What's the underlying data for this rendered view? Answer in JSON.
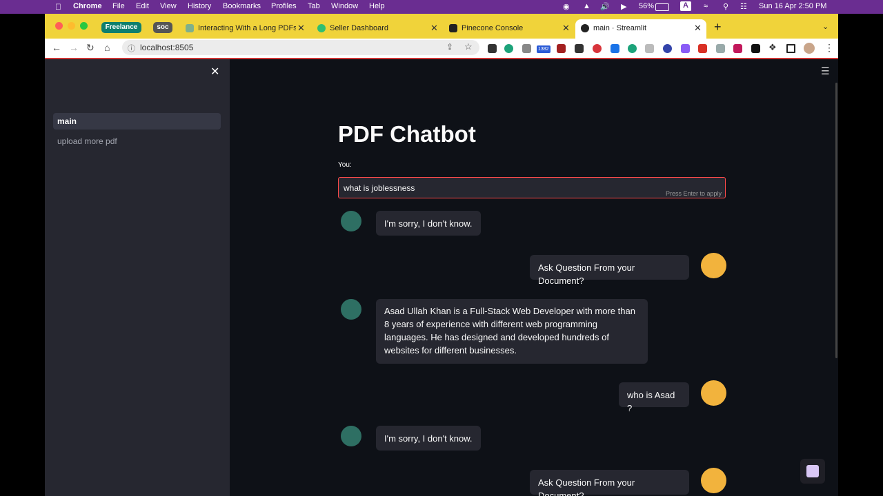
{
  "menubar": {
    "app": "Chrome",
    "items": [
      "File",
      "Edit",
      "View",
      "History",
      "Bookmarks",
      "Profiles",
      "Tab",
      "Window",
      "Help"
    ],
    "battery": "56%",
    "keyboard": "A",
    "datetime": "Sun 16 Apr  2:50 PM"
  },
  "tabbar": {
    "groups": [
      "Freelance",
      "soc"
    ],
    "tabs": [
      {
        "label": "Interacting With a Long PDFs W"
      },
      {
        "label": "Seller Dashboard"
      },
      {
        "label": "Pinecone Console"
      },
      {
        "label": "main · Streamlit"
      }
    ],
    "new_tab": "+"
  },
  "toolbar": {
    "url": "localhost:8505",
    "ext_badge": "1382"
  },
  "sidebar": {
    "items": [
      {
        "label": "main"
      },
      {
        "label": "upload more pdf"
      }
    ]
  },
  "main": {
    "title": "PDF Chatbot",
    "input_label": "You:",
    "input_value": "what is joblessness",
    "input_hint": "Press Enter to apply",
    "messages": [
      {
        "role": "bot",
        "text": "I'm sorry, I don't know."
      },
      {
        "role": "user",
        "text": "Ask Question From your Document?"
      },
      {
        "role": "bot",
        "text": "Asad Ullah Khan is a Full-Stack Web Developer with more than 8 years of experience with different web programming languages. He has designed and developed hundreds of websites for different businesses."
      },
      {
        "role": "user",
        "text": "who is Asad ?"
      },
      {
        "role": "bot",
        "text": "I'm sorry, I don't know."
      },
      {
        "role": "user",
        "text": "Ask Question From your Document?"
      }
    ]
  },
  "icons": {
    "apple": "apple-icon",
    "close": "close-icon",
    "menu": "hamburger-icon",
    "bot": "robot-avatar-icon",
    "user": "nerd-face-avatar-icon"
  },
  "colors": {
    "menubar": "#6a2d91",
    "tabbar": "#f0d33a",
    "sidebar": "#262730",
    "main_bg": "#0e1117",
    "input_border": "#ff4b4b",
    "freelance_group": "#0e7f6e"
  }
}
